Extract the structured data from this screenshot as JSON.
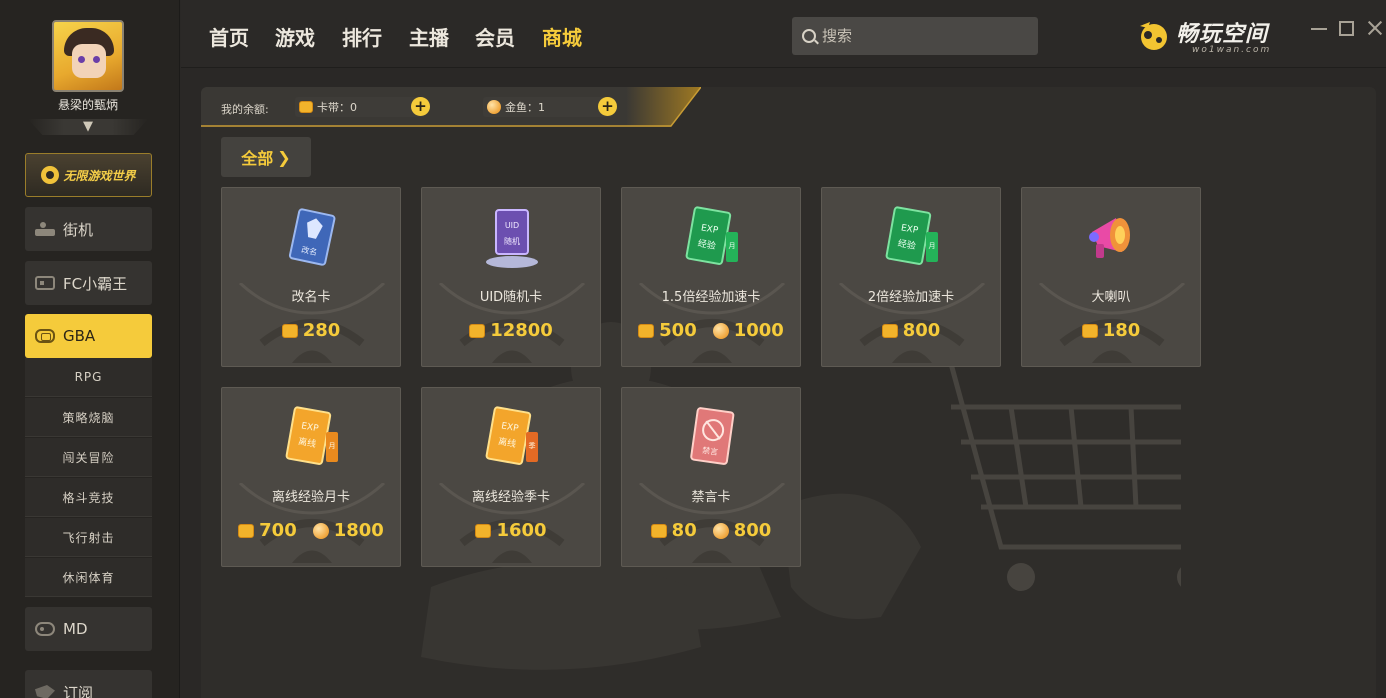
{
  "user": {
    "name": "悬梁的甄炳"
  },
  "sidebar": {
    "world_label": "无限游戏世界",
    "items": [
      {
        "label": "街机",
        "icon": "arcade-icon"
      },
      {
        "label": "FC小霸王",
        "icon": "fc-console-icon"
      },
      {
        "label": "GBA",
        "icon": "gba-icon",
        "active": true
      },
      {
        "label": "MD",
        "icon": "md-gamepad-icon"
      },
      {
        "label": "订阅",
        "icon": "subscribe-icon"
      }
    ],
    "gba_sub": [
      "RPG",
      "策略烧脑",
      "闯关冒险",
      "格斗竞技",
      "飞行射击",
      "休闲体育"
    ]
  },
  "header": {
    "tabs": [
      "首页",
      "游戏",
      "排行",
      "主播",
      "会员",
      "商城"
    ],
    "active_tab": "商城",
    "search_placeholder": "搜索",
    "brand_name": "畅玩空间",
    "brand_sub": "wo1wan.com"
  },
  "balance": {
    "label": "我的余额:",
    "kadai": "卡带：0",
    "jinyu": "金鱼：1"
  },
  "filter": {
    "label": "全部"
  },
  "products": [
    {
      "name": "改名卡",
      "price_coin": "280",
      "price_gold": null,
      "icon": "rename-card-icon"
    },
    {
      "name": "UID随机卡",
      "price_coin": "12800",
      "price_gold": null,
      "icon": "uid-random-card-icon"
    },
    {
      "name": "1.5倍经验加速卡",
      "price_coin": "500",
      "price_gold": "1000",
      "icon": "exp-boost-card-icon"
    },
    {
      "name": "2倍经验加速卡",
      "price_coin": "800",
      "price_gold": null,
      "icon": "exp-boost-card-icon"
    },
    {
      "name": "大喇叭",
      "price_coin": "180",
      "price_gold": null,
      "icon": "megaphone-icon"
    },
    {
      "name": "离线经验月卡",
      "price_coin": "700",
      "price_gold": "1800",
      "icon": "offline-exp-month-card-icon"
    },
    {
      "name": "离线经验季卡",
      "price_coin": "1600",
      "price_gold": null,
      "icon": "offline-exp-season-card-icon"
    },
    {
      "name": "禁言卡",
      "price_coin": "80",
      "price_gold": "800",
      "icon": "mute-card-icon"
    }
  ],
  "colors": {
    "accent": "#f5cb3b",
    "background": "#2a2826",
    "card": "#4b4843"
  }
}
